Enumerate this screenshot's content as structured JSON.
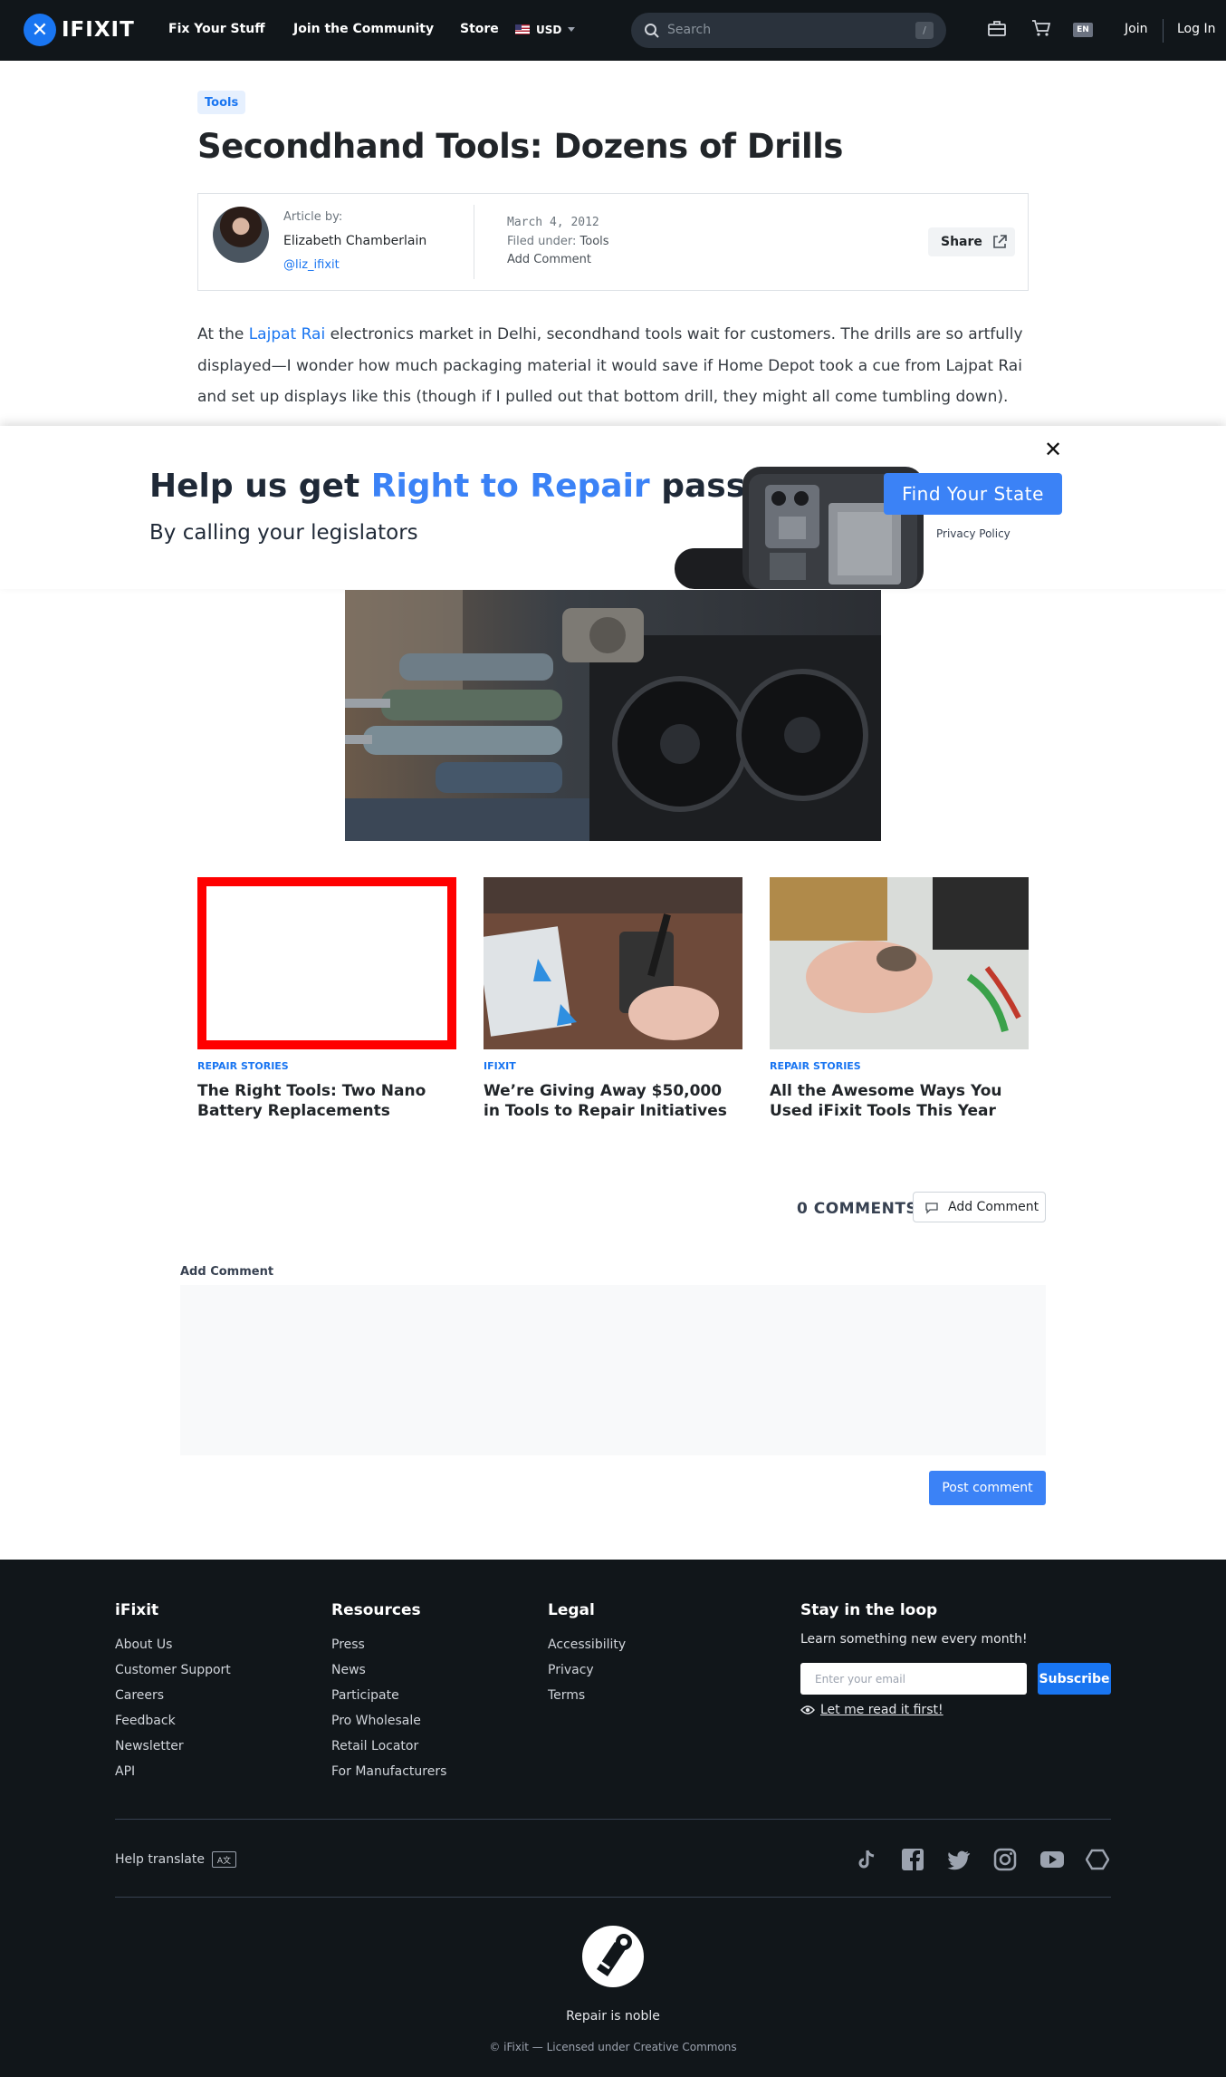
{
  "header": {
    "brand": "IFIXIT",
    "nav": [
      "Fix Your Stuff",
      "Join the Community",
      "Store"
    ],
    "currency": "USD",
    "search_placeholder": "Search",
    "search_shortcut": "/",
    "language": "EN",
    "join": "Join",
    "login": "Log In"
  },
  "article": {
    "tag": "Tools",
    "title": "Secondhand Tools: Dozens of Drills",
    "byline_label": "Article by:",
    "author": "Elizabeth Chamberlain",
    "handle": "@liz_ifixit",
    "date": "March 4, 2012",
    "filed_label": "Filed under:",
    "filed_value": "Tools",
    "add_comment": "Add Comment",
    "share": "Share",
    "para_before_link": "At the ",
    "para_link": "Lajpat Rai",
    "para_after_link": " electronics market in Delhi, secondhand tools wait for customers. The drills are so artfully displayed—I wonder how much packaging material it would save if Home Depot took a cue from Lajpat Rai and set up displays like this (though if I pulled out that bottom drill, they might all come tumbling down)."
  },
  "banner": {
    "title_prefix": "Help us get ",
    "title_highlight": "Right to Repair",
    "title_suffix": " passed",
    "subtitle": "By calling your legislators",
    "cta": "Find Your State",
    "privacy": "Privacy Policy",
    "close": "✕"
  },
  "related": [
    {
      "category": "REPAIR STORIES",
      "title": "The Right Tools: Two Nano Battery Replacements"
    },
    {
      "category": "IFIXIT",
      "title": "We’re Giving Away $50,000 in Tools to Repair Initiatives"
    },
    {
      "category": "REPAIR STORIES",
      "title": "All the Awesome Ways You Used iFixit Tools This Year"
    }
  ],
  "comments": {
    "count_label": "0 COMMENTS",
    "add_button": "Add Comment",
    "form_label": "Add Comment",
    "post_button": "Post comment"
  },
  "footer": {
    "columns": [
      {
        "heading": "iFixit",
        "links": [
          "About Us",
          "Customer Support",
          "Careers",
          "Feedback",
          "Newsletter",
          "API"
        ]
      },
      {
        "heading": "Resources",
        "links": [
          "Press",
          "News",
          "Participate",
          "Pro Wholesale",
          "Retail Locator",
          "For Manufacturers"
        ]
      },
      {
        "heading": "Legal",
        "links": [
          "Accessibility",
          "Privacy",
          "Terms"
        ]
      }
    ],
    "loop_heading": "Stay in the loop",
    "loop_sub": "Learn something new every month!",
    "email_placeholder": "Enter your email",
    "subscribe": "Subscribe",
    "read_first": "Let me read it first!",
    "help_translate": "Help translate",
    "tagline": "Repair is noble",
    "copyright": "© iFixit — Licensed under Creative Commons",
    "social_icons": [
      "tiktok-icon",
      "facebook-icon",
      "twitter-icon",
      "instagram-icon",
      "youtube-icon",
      "hexagon-icon"
    ]
  },
  "colors": {
    "header_bg": "#11161a",
    "accent": "#1975f1",
    "banner_accent": "#3b82f6"
  }
}
